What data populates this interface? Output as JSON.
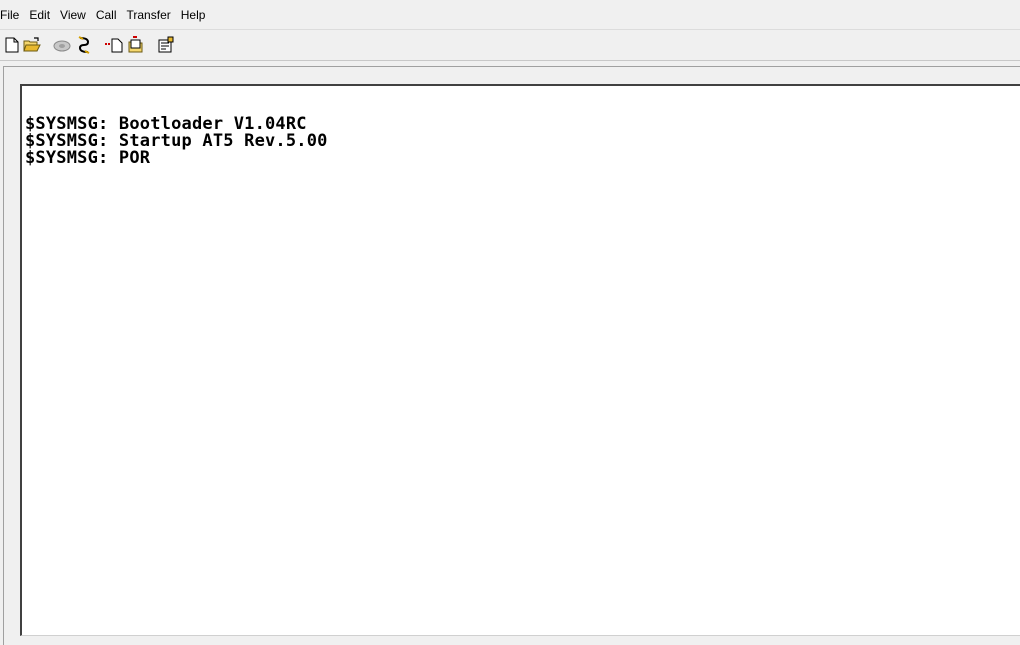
{
  "menu": {
    "items": [
      "File",
      "Edit",
      "View",
      "Call",
      "Transfer",
      "Help"
    ]
  },
  "toolbar": {
    "buttons": [
      {
        "name": "new-icon"
      },
      {
        "name": "open-icon"
      },
      {
        "name": "call-icon"
      },
      {
        "name": "disconnect-icon"
      },
      {
        "name": "send-icon"
      },
      {
        "name": "receive-icon"
      },
      {
        "name": "properties-icon"
      }
    ]
  },
  "terminal": {
    "lines": [
      "$SYSMSG: Bootloader V1.04RC",
      "$SYSMSG: Startup AT5 Rev.5.00",
      "$SYSMSG: POR"
    ]
  },
  "colors": {
    "chrome": "#f0f0f0",
    "terminal_bg": "#ffffff",
    "text": "#000000"
  }
}
